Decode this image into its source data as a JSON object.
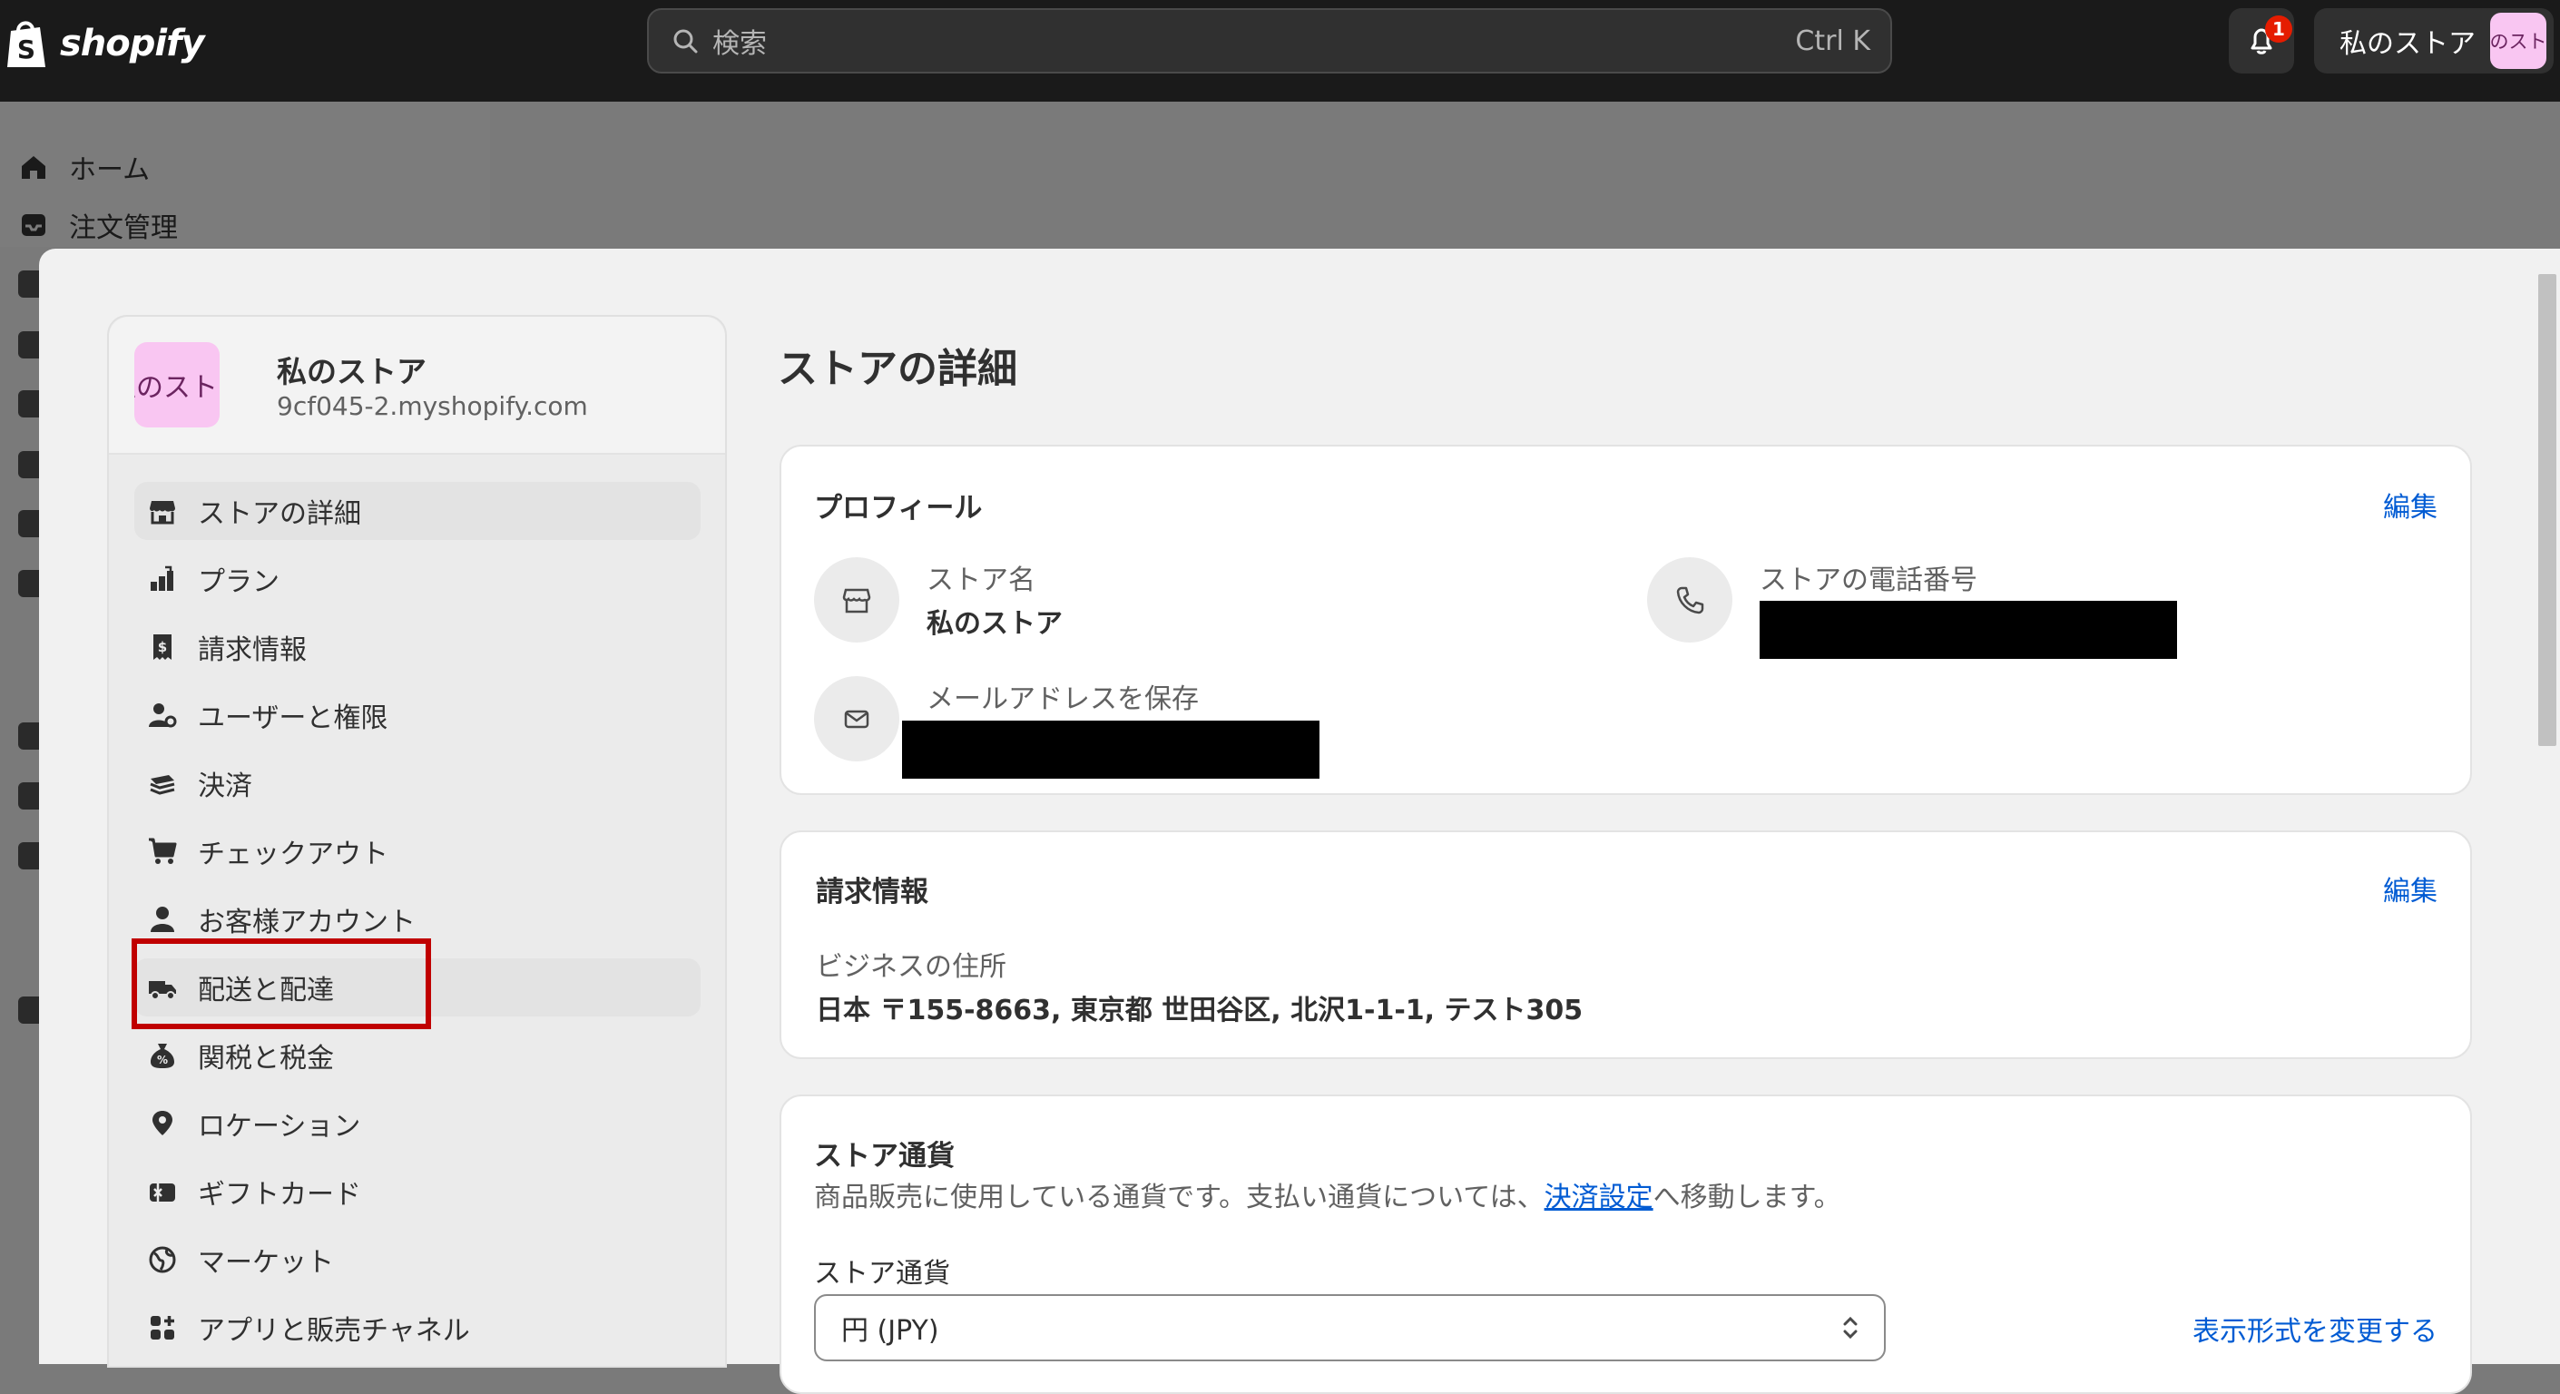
{
  "topbar": {
    "brand": "shopify",
    "search_placeholder": "検索",
    "search_shortcut": "Ctrl K",
    "notification_count": "1",
    "store_label": "私のストア",
    "store_avatar_text": "私のストア"
  },
  "background_nav": {
    "items": [
      {
        "label": "ホーム",
        "icon": "home-icon"
      },
      {
        "label": "注文管理",
        "icon": "inbox-icon"
      }
    ]
  },
  "settings_nav": {
    "avatar_text": "私のストア",
    "store_name": "私のストア",
    "store_domain": "9cf045-2.myshopify.com",
    "items": [
      {
        "label": "ストアの詳細",
        "icon": "store-icon",
        "state": "selected"
      },
      {
        "label": "プラン",
        "icon": "plan-icon"
      },
      {
        "label": "請求情報",
        "icon": "receipt-icon"
      },
      {
        "label": "ユーザーと権限",
        "icon": "users-icon"
      },
      {
        "label": "決済",
        "icon": "payment-icon"
      },
      {
        "label": "チェックアウト",
        "icon": "cart-icon"
      },
      {
        "label": "お客様アカウント",
        "icon": "person-icon"
      },
      {
        "label": "配送と配達",
        "icon": "truck-icon",
        "state": "hover"
      },
      {
        "label": "関税と税金",
        "icon": "tax-icon"
      },
      {
        "label": "ロケーション",
        "icon": "location-icon"
      },
      {
        "label": "ギフトカード",
        "icon": "gift-card-icon"
      },
      {
        "label": "マーケット",
        "icon": "globe-icon"
      },
      {
        "label": "アプリと販売チャネル",
        "icon": "apps-icon"
      }
    ]
  },
  "main": {
    "page_title": "ストアの詳細",
    "profile": {
      "title": "プロフィール",
      "edit_label": "編集",
      "store_name_label": "ストア名",
      "store_name_value": "私のストア",
      "phone_label": "ストアの電話番号",
      "email_label": "メールアドレスを保存"
    },
    "billing": {
      "title": "請求情報",
      "edit_label": "編集",
      "address_label": "ビジネスの住所",
      "address_value": "日本 〒155-8663, 東京都 世田谷区, 北沢1-1-1, テスト305"
    },
    "currency": {
      "title": "ストア通貨",
      "description_before": "商品販売に使用している通貨です。支払い通貨については、",
      "description_link": "決済設定",
      "description_after": "へ移動します。",
      "field_label": "ストア通貨",
      "selected_value": "円 (JPY)",
      "change_format_label": "表示形式を変更する"
    }
  },
  "colors": {
    "topbar": "#1a1a1a",
    "link": "#005bd3",
    "highlight": "#c00000",
    "avatar": "#f9c6f2",
    "badge": "#e51c00"
  }
}
